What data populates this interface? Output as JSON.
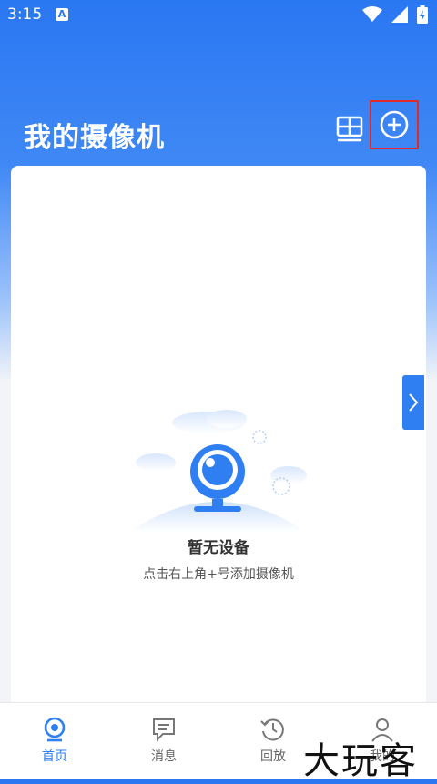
{
  "status_bar": {
    "time": "3:15",
    "notification_icon": "A"
  },
  "header": {
    "title": "我的摄像机"
  },
  "empty_state": {
    "title": "暂无设备",
    "hint": "点击右上角+号添加摄像机"
  },
  "tabs": [
    {
      "label": "首页",
      "icon": "camera-home-icon",
      "active": true
    },
    {
      "label": "消息",
      "icon": "message-icon",
      "active": false
    },
    {
      "label": "回放",
      "icon": "history-icon",
      "active": false
    },
    {
      "label": "我的",
      "icon": "user-icon",
      "active": false
    }
  ],
  "watermark": {
    "text": "大玩客"
  },
  "colors": {
    "accent": "#2f7ff2",
    "highlight_box": "#e02a2a"
  }
}
